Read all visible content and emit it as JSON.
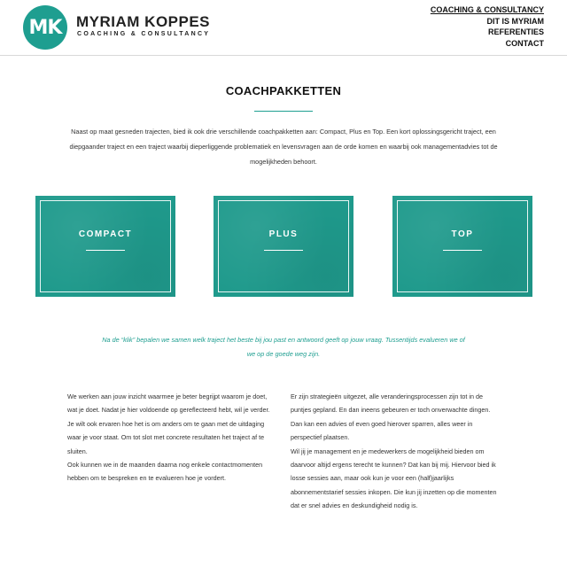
{
  "logo": {
    "monogram": "MK",
    "name": "MYRIAM KOPPES",
    "tagline": "COACHING & CONSULTANCY"
  },
  "nav": {
    "items": [
      "COACHING & CONSULTANCY",
      "DIT IS MYRIAM",
      "REFERENTIES",
      "CONTACT"
    ],
    "active": "COACHING & CONSULTANCY"
  },
  "page": {
    "title": "COACHPAKKETTEN",
    "intro": "Naast op maat gesneden trajecten, bied ik ook drie verschillende coachpakketten aan: Compact, Plus en Top. Een kort oplossingsgericht traject, een diepgaander traject en een traject waarbij dieperliggende problematiek en levensvragen aan de orde komen en waarbij ook managementadvies tot de mogelijkheden behoort."
  },
  "packages": [
    "COMPACT",
    "PLUS",
    "TOP"
  ],
  "quote": "Na de “klik” bepalen we samen welk traject het beste bij jou past en antwoord geeft op jouw vraag. Tussentijds evalueren we of we op de goede weg zijn.",
  "columns": {
    "left": [
      "We werken aan jouw inzicht waarmee je beter begrijpt waarom je doet, wat je doet. Nadat je hier voldoende op gereflecteerd hebt, wil je verder. Je wilt ook ervaren hoe het is om anders om te gaan met de uitdaging waar je voor staat. Om tot slot met concrete resultaten het traject af te sluiten.",
      "Ook kunnen we in de maanden daarna nog enkele contactmomenten hebben om te bespreken en te evalueren hoe je vordert."
    ],
    "right": [
      "Er zijn strategieën uitgezet, alle veranderingsprocessen zijn tot in de puntjes gepland. En dan ineens gebeuren er toch onverwachte dingen. Dan kan een advies of even goed hierover sparren, alles weer in perspectief plaatsen.",
      "Wil jij je management en je medewerkers de mogelijkheid bieden om daarvoor altijd ergens terecht te kunnen? Dat kan bij mij. Hiervoor bied ik losse sessies aan, maar ook kun je voor een (half)jaarlijks abonnementstarief sessies inkopen. Die kun jij inzetten op die momenten dat er snel advies en deskundigheid nodig is."
    ]
  },
  "colors": {
    "accent": "#1e9e90",
    "package_bg": "#1f9a8c"
  }
}
